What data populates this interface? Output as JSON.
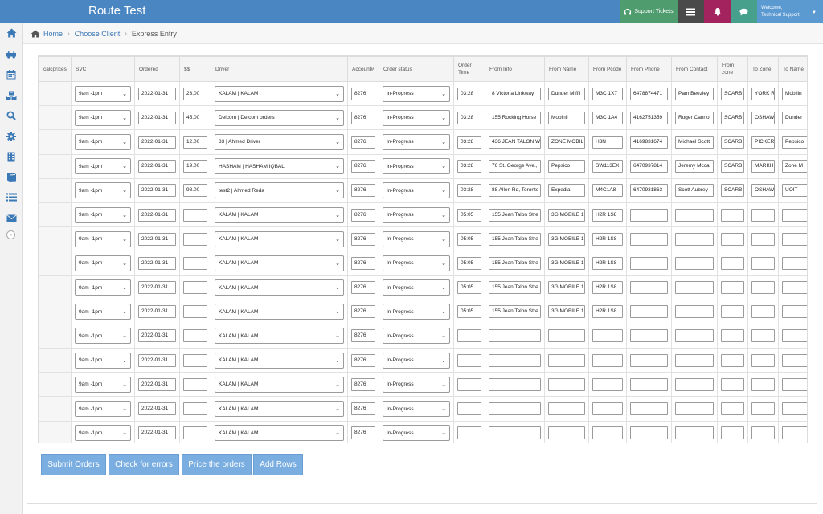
{
  "header": {
    "title": "Route Test",
    "support_label": "Support Tickets",
    "welcome_line1": "Welcome,",
    "welcome_line2": "Technical Support",
    "colors": {
      "bar": "#4a86c2",
      "support": "#4f9d6f",
      "list": "#4a4a4a",
      "bell": "#a3235f",
      "chat": "#46a08c",
      "user": "#5b99d1"
    }
  },
  "sidebar": {
    "icons": [
      "home-icon",
      "car-icon",
      "calendar-icon",
      "cubes-icon",
      "search-icon",
      "gear-icon",
      "building-icon",
      "book-icon",
      "list-icon",
      "envelope-icon"
    ],
    "collapse": "»"
  },
  "breadcrumb": {
    "home": "Home",
    "choose_client": "Choose Client",
    "current": "Express Entry"
  },
  "table": {
    "headers": [
      "calcprices",
      "SVC",
      "Ordered",
      "$$",
      "Driver",
      "Account#",
      "Order status",
      "Order Time",
      "From Info",
      "From Name",
      "From Pcode",
      "From Phone",
      "From Contact",
      "From zone",
      "To Zone",
      "To Name"
    ],
    "rows": [
      [
        "",
        "9am -1pm",
        "2022-01-31",
        "23.00",
        "KALAM | KALAM",
        "8276",
        "In-Progress",
        "03:28",
        "8 Victoria Linkway,",
        "Dunder Miffli",
        "M3C 1X7",
        "6478874471",
        "Pam Beezley",
        "SCARB",
        "YORK R",
        "Mobilin"
      ],
      [
        "",
        "9am -1pm",
        "2022-01-31",
        "45.00",
        "Delcom | Delcom orders",
        "8276",
        "In-Progress",
        "03:28",
        "155 Rocking Horse",
        "Mobinil",
        "M3C 1A4",
        "4162751359",
        "Roger Canno",
        "SCARB",
        "OSHAW",
        "Dunder"
      ],
      [
        "",
        "9am -1pm",
        "2022-01-31",
        "12.00",
        "33 | Ahmed Driver",
        "8276",
        "In-Progress",
        "03:28",
        "436 JEAN TALON WE",
        "ZONE MOBIL",
        "H3N",
        "4169831674",
        "Michael Scott",
        "SCARB",
        "PICKER",
        "Pepsico"
      ],
      [
        "",
        "9am -1pm",
        "2022-01-31",
        "19.00",
        "HASHAM | HASHAM IQBAL",
        "8276",
        "In-Progress",
        "03:28",
        "76 St. George Ave.,",
        "Pepsico",
        "SW113EX",
        "6470937814",
        "Jeremy Mccai",
        "SCARB",
        "MARKH",
        "Zone M"
      ],
      [
        "",
        "9am -1pm",
        "2022-01-31",
        "98.00",
        "test2 | Ahmed Reda",
        "8276",
        "In-Progress",
        "03:28",
        "88 Allen Rd, Toronto",
        "Expedia",
        "M4C1A8",
        "6470931863",
        "Scott Aubrey",
        "SCARB",
        "OSHAW",
        "UOIT"
      ],
      [
        "",
        "9am -1pm",
        "2022-01-31",
        "",
        "KALAM | KALAM",
        "8276",
        "In-Progress",
        "05:05",
        "155 Jean Talon Stre",
        "3G MOBILE 1",
        "H2R 1S8",
        "",
        "",
        "",
        "",
        ""
      ],
      [
        "",
        "9am -1pm",
        "2022-01-31",
        "",
        "KALAM | KALAM",
        "8276",
        "In-Progress",
        "05:05",
        "155 Jean Talon Stre",
        "3G MOBILE 1",
        "H2R 1S8",
        "",
        "",
        "",
        "",
        ""
      ],
      [
        "",
        "9am -1pm",
        "2022-01-31",
        "",
        "KALAM | KALAM",
        "8276",
        "In-Progress",
        "05:05",
        "155 Jean Talon Stre",
        "3G MOBILE 1",
        "H2R 1S8",
        "",
        "",
        "",
        "",
        ""
      ],
      [
        "",
        "9am -1pm",
        "2022-01-31",
        "",
        "KALAM | KALAM",
        "8276",
        "In-Progress",
        "05:05",
        "155 Jean Talon Stre",
        "3G MOBILE 1",
        "H2R 1S8",
        "",
        "",
        "",
        "",
        ""
      ],
      [
        "",
        "9am -1pm",
        "2022-01-31",
        "",
        "KALAM | KALAM",
        "8276",
        "In-Progress",
        "05:05",
        "155 Jean Talon Stre",
        "3G MOBILE 1",
        "H2R 1S8",
        "",
        "",
        "",
        "",
        ""
      ],
      [
        "",
        "9am -1pm",
        "2022-01-31",
        "",
        "KALAM | KALAM",
        "8276",
        "In-Progress",
        "",
        "",
        "",
        "",
        "",
        "",
        "",
        "",
        ""
      ],
      [
        "",
        "9am -1pm",
        "2022-01-31",
        "",
        "KALAM | KALAM",
        "8276",
        "In-Progress",
        "",
        "",
        "",
        "",
        "",
        "",
        "",
        "",
        ""
      ],
      [
        "",
        "9am -1pm",
        "2022-01-31",
        "",
        "KALAM | KALAM",
        "8276",
        "In-Progress",
        "",
        "",
        "",
        "",
        "",
        "",
        "",
        "",
        ""
      ],
      [
        "",
        "9am -1pm",
        "2022-01-31",
        "",
        "KALAM | KALAM",
        "8276",
        "In-Progress",
        "",
        "",
        "",
        "",
        "",
        "",
        "",
        "",
        ""
      ],
      [
        "",
        "9am -1pm",
        "2022-01-31",
        "",
        "KALAM | KALAM",
        "8276",
        "In-Progress",
        "",
        "",
        "",
        "",
        "",
        "",
        "",
        "",
        ""
      ]
    ]
  },
  "buttons": {
    "submit": "Submit Orders",
    "check": "Check for errors",
    "price": "Price the orders",
    "add": "Add Rows",
    "color": "#7aaee0"
  }
}
